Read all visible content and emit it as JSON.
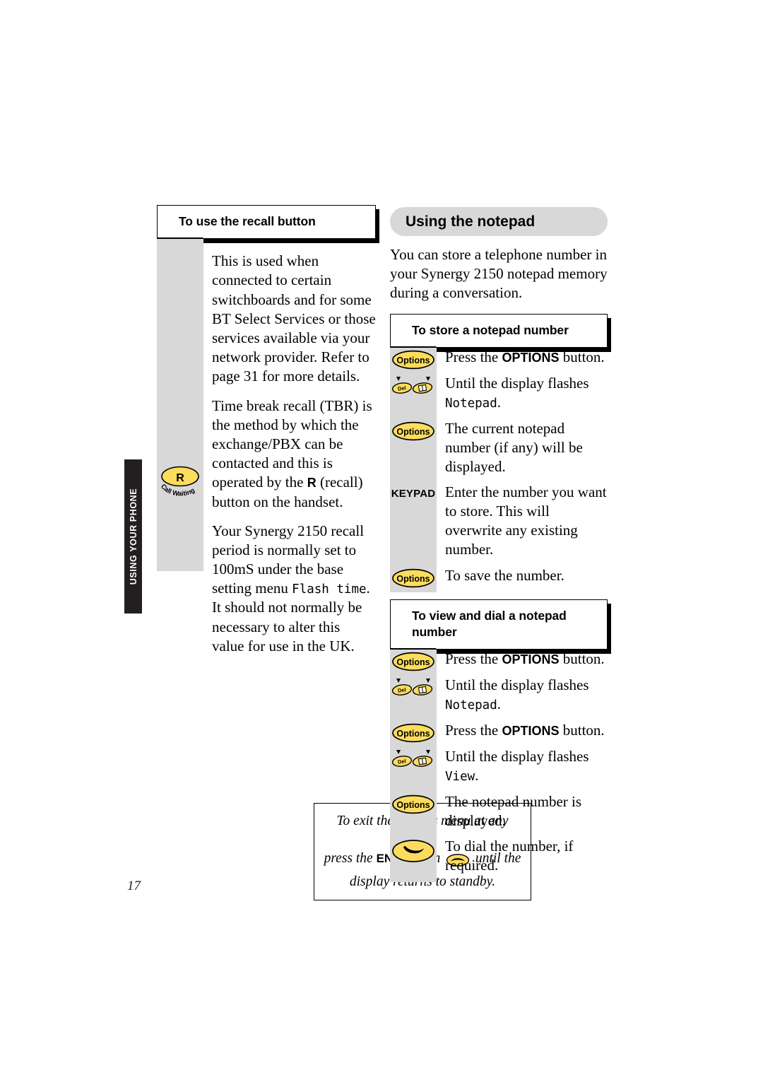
{
  "side_tab": {
    "label": "USING YOUR PHONE"
  },
  "page_number": "17",
  "left_column": {
    "header": "To use the recall button",
    "paragraphs": [
      "This is used when connected to certain switchboards and for some BT Select Services or those services available via your network provider. Refer to page 31 for more details.",
      "Time break recall (TBR) is the method by which the exchange/PBX can be contacted and this is operated by the R (recall) button on the handset.",
      "Your Synergy 2150 recall period is normally set to 100mS under the base setting menu Flash time. It should not normally be necessary to alter this value for use in the UK."
    ],
    "para2_pre": "Time break recall (TBR) is the method by which the exchange/PBX can be contacted and this is operated by the ",
    "para2_bold": "R",
    "para2_post": " (recall) button on the handset.",
    "para3_pre": "Your Synergy 2150 recall period is normally set to 100mS under the base setting menu ",
    "para3_lcd": "Flash time",
    "para3_post": ". It should not normally be necessary to alter this value for use in the UK.",
    "recall_key": {
      "letter": "R",
      "caption": "Call Waiting"
    },
    "note": {
      "line1": "To exit the options menu at any time,",
      "line2_pre": "press the ",
      "line2_bold": "END",
      "line2_mid": " button ",
      "line2_post": " until the",
      "line3": "display returns to standby."
    }
  },
  "right_column": {
    "title": "Using the notepad",
    "intro": "You can store a telephone number in your Synergy 2150 notepad memory during a conversation.",
    "sections": [
      {
        "header": "To store a notepad number",
        "rows": [
          {
            "icon": "options-button-icon",
            "pre": "Press the ",
            "bold": "OPTIONS",
            "post": " button.",
            "lcd": "",
            "tail": ""
          },
          {
            "icon": "scroll-buttons-icon",
            "pre": "Until the display flashes ",
            "bold": "",
            "post": "",
            "lcd": "Notepad",
            "tail": "."
          },
          {
            "icon": "options-button-icon",
            "pre": "The current notepad number (if any) will be displayed.",
            "bold": "",
            "post": "",
            "lcd": "",
            "tail": ""
          },
          {
            "icon": "keypad-label",
            "pre": "Enter the number you want to store. This will overwrite any existing number.",
            "bold": "",
            "post": "",
            "lcd": "",
            "tail": ""
          },
          {
            "icon": "options-button-icon",
            "pre": "To save the number.",
            "bold": "",
            "post": "",
            "lcd": "",
            "tail": ""
          }
        ]
      },
      {
        "header": "To view and dial a notepad number",
        "rows": [
          {
            "icon": "options-button-icon",
            "pre": "Press the ",
            "bold": "OPTIONS",
            "post": " button.",
            "lcd": "",
            "tail": ""
          },
          {
            "icon": "scroll-buttons-icon",
            "pre": "Until the display flashes ",
            "bold": "",
            "post": "",
            "lcd": "Notepad",
            "tail": "."
          },
          {
            "icon": "options-button-icon",
            "pre": "Press the ",
            "bold": "OPTIONS",
            "post": " button.",
            "lcd": "",
            "tail": ""
          },
          {
            "icon": "scroll-buttons-icon",
            "pre": "Until the display flashes ",
            "bold": "",
            "post": "",
            "lcd": "View",
            "tail": "."
          },
          {
            "icon": "options-button-icon",
            "pre": "The notepad number is displayed.",
            "bold": "",
            "post": "",
            "lcd": "",
            "tail": ""
          },
          {
            "icon": "talk-button-icon",
            "pre": "To dial the number, if required.",
            "bold": "",
            "post": "",
            "lcd": "",
            "tail": ""
          }
        ]
      }
    ],
    "labels": {
      "keypad": "KEYPAD",
      "options": "Options",
      "del": "Del"
    }
  },
  "colors": {
    "button_yellow": "#fcdc5c",
    "grey_rail": "#d8d8d8",
    "tab_black": "#231f20"
  }
}
